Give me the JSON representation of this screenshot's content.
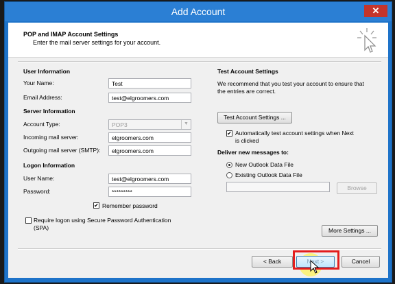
{
  "window": {
    "title": "Add Account",
    "close_glyph": "✕"
  },
  "header": {
    "title": "POP and IMAP Account Settings",
    "subtitle": "Enter the mail server settings for your account.",
    "icon": "cursor-click-icon"
  },
  "user_info": {
    "heading": "User Information",
    "name_label": "Your Name:",
    "name_value": "Test",
    "email_label": "Email Address:",
    "email_value": "test@elgroomers.com"
  },
  "server_info": {
    "heading": "Server Information",
    "account_type_label": "Account Type:",
    "account_type_value": "POP3",
    "incoming_label": "Incoming mail server:",
    "incoming_value": "elgroomers.com",
    "outgoing_label": "Outgoing mail server (SMTP):",
    "outgoing_value": "elgroomers.com"
  },
  "logon_info": {
    "heading": "Logon Information",
    "user_label": "User Name:",
    "user_value": "test@elgroomers.com",
    "password_label": "Password:",
    "password_value": "*********",
    "remember_label": "Remember password",
    "remember_checked": true,
    "spa_label_line1": "Require logon using Secure Password Authentication",
    "spa_label_line2": "(SPA)",
    "spa_checked": false
  },
  "test_settings": {
    "heading": "Test Account Settings",
    "description_line1": "We recommend that you test your account to ensure that",
    "description_line2": "the entries are correct.",
    "test_button": "Test Account Settings ...",
    "auto_test_label_line1": "Automatically test account settings when Next",
    "auto_test_label_line2": "is clicked",
    "auto_test_checked": true
  },
  "deliver": {
    "heading": "Deliver new messages to:",
    "option_new": "New Outlook Data File",
    "option_existing": "Existing Outlook Data File",
    "selected": "new",
    "existing_path": "",
    "browse_button": "Browse"
  },
  "buttons": {
    "more_settings": "More Settings ...",
    "back": "< Back",
    "next": "Next >",
    "cancel": "Cancel"
  },
  "colors": {
    "title_bar": "#2b7fd4",
    "close_button": "#c4352b",
    "highlight": "#e31d1d",
    "cursor_glow": "#fff35a"
  }
}
